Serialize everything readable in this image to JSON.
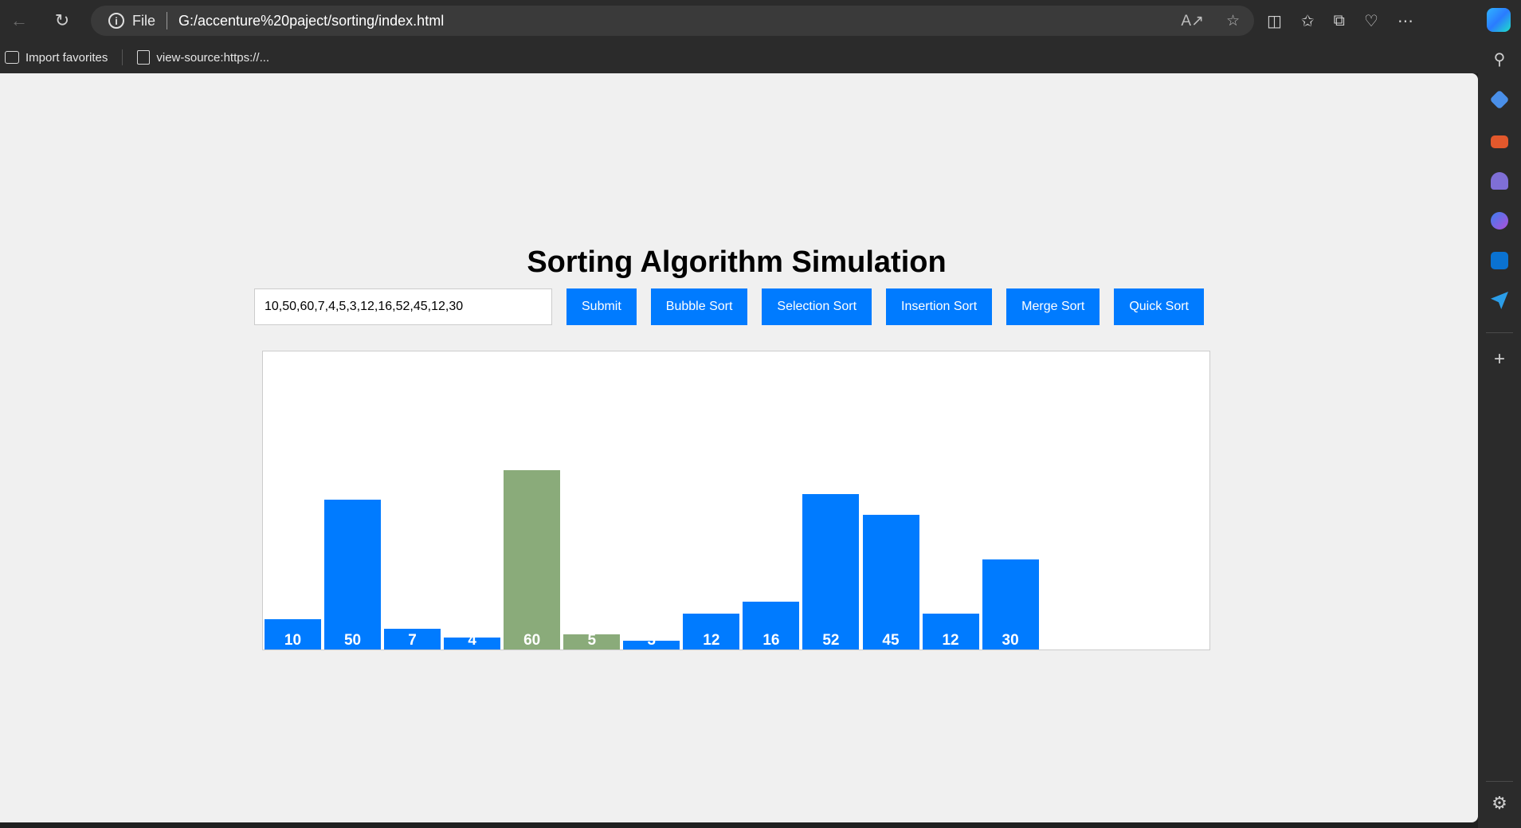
{
  "browser": {
    "scheme": "File",
    "url": "G:/accenture%20paject/sorting/index.html",
    "bookmarks": [
      {
        "label": "Import favorites",
        "icon": "import-favorites-icon"
      },
      {
        "label": "view-source:https://...",
        "icon": "page-icon"
      }
    ],
    "toolbar_icons": [
      "read-aloud-icon",
      "favorite-star-icon",
      "split-screen-icon",
      "favorites-icon",
      "collections-icon",
      "browser-essentials-icon",
      "more-icon",
      "copilot-icon"
    ],
    "sidebar_icons": [
      "search-icon",
      "shopping-tag-icon",
      "tools-icon",
      "games-icon",
      "office-icon",
      "outlook-icon",
      "send-icon",
      "add-icon",
      "settings-icon"
    ]
  },
  "page": {
    "title": "Sorting Algorithm Simulation",
    "input_value": "10,50,60,7,4,5,3,12,16,52,45,12,30",
    "buttons": {
      "submit": "Submit",
      "bubble": "Bubble Sort",
      "selection": "Selection Sort",
      "insertion": "Insertion Sort",
      "merge": "Merge Sort",
      "quick": "Quick Sort"
    },
    "accent_color": "#007bff",
    "highlight_color": "#8aab7a"
  },
  "chart_data": {
    "type": "bar",
    "values": [
      10,
      50,
      7,
      4,
      60,
      5,
      3,
      12,
      16,
      52,
      45,
      12,
      30
    ],
    "labels": [
      "10",
      "50",
      "7",
      "4",
      "60",
      "5",
      "3",
      "12",
      "16",
      "52",
      "45",
      "12",
      "30"
    ],
    "highlighted": [
      4,
      5
    ],
    "bar_color": "#007bff",
    "highlight_color": "#8aab7a"
  }
}
